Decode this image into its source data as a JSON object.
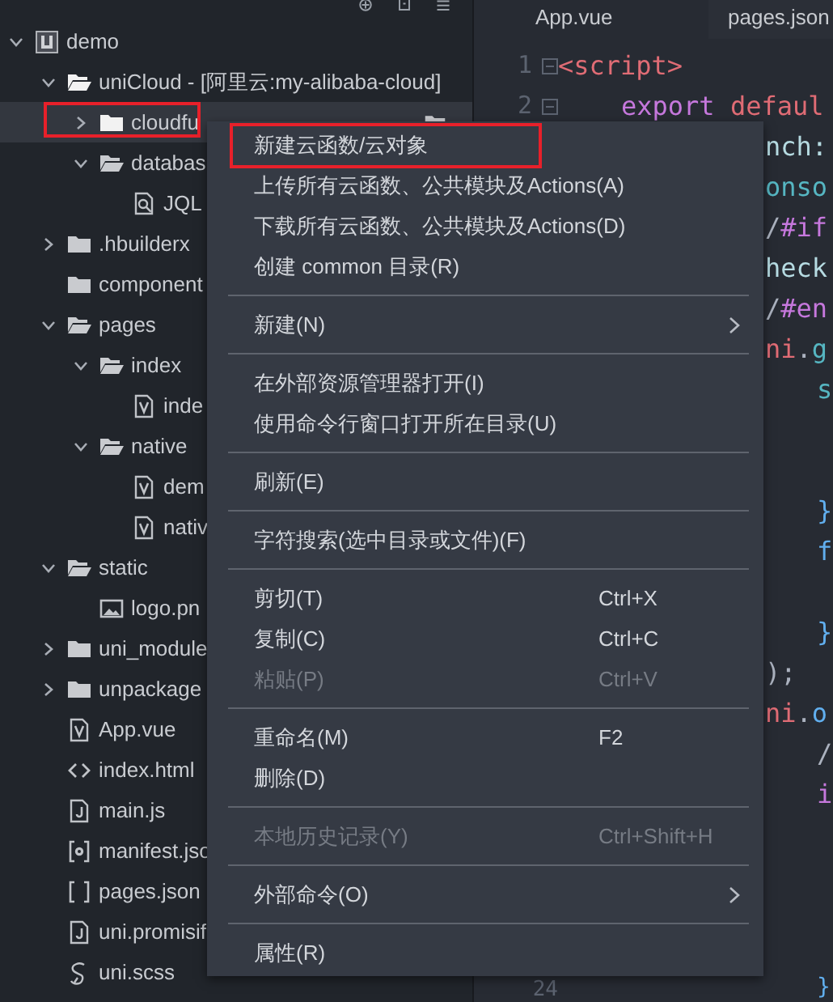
{
  "explorer": {
    "tree": [
      {
        "label": "demo",
        "kind": "project",
        "selected": false,
        "marked": false,
        "expanded": true,
        "children": [
          {
            "label": "uniCloud - [阿里云:my-alibaba-cloud]",
            "kind": "cloud-folder",
            "selected": false,
            "marked": false,
            "expanded": true,
            "children": [
              {
                "label": "cloudfu",
                "kind": "cloud-folder",
                "selected": true,
                "marked": true,
                "expanded": false
              },
              {
                "label": "databas",
                "kind": "folder",
                "selected": false,
                "marked": false,
                "expanded": true,
                "children": [
                  {
                    "label": "JQL",
                    "kind": "search-doc",
                    "selected": false,
                    "marked": false
                  }
                ]
              }
            ]
          },
          {
            "label": ".hbuilderx",
            "kind": "folder",
            "selected": false,
            "marked": false,
            "expanded": false
          },
          {
            "label": "component",
            "kind": "folder",
            "selected": false,
            "marked": false
          },
          {
            "label": "pages",
            "kind": "folder",
            "selected": false,
            "marked": false,
            "expanded": true,
            "children": [
              {
                "label": "index",
                "kind": "folder",
                "selected": false,
                "marked": false,
                "expanded": true,
                "children": [
                  {
                    "label": "inde",
                    "kind": "vue",
                    "selected": false,
                    "marked": false
                  }
                ]
              },
              {
                "label": "native",
                "kind": "folder",
                "selected": false,
                "marked": false,
                "expanded": true,
                "children": [
                  {
                    "label": "dem",
                    "kind": "vue",
                    "selected": false,
                    "marked": false
                  },
                  {
                    "label": "nativ",
                    "kind": "vue",
                    "selected": false,
                    "marked": false
                  }
                ]
              }
            ]
          },
          {
            "label": "static",
            "kind": "folder",
            "selected": false,
            "marked": false,
            "expanded": true,
            "children": [
              {
                "label": "logo.pn",
                "kind": "image",
                "selected": false,
                "marked": false
              }
            ]
          },
          {
            "label": "uni_module",
            "kind": "folder",
            "selected": false,
            "marked": false,
            "expanded": false
          },
          {
            "label": "unpackage",
            "kind": "folder",
            "selected": false,
            "marked": false,
            "expanded": false
          },
          {
            "label": "App.vue",
            "kind": "vue",
            "selected": false,
            "marked": false
          },
          {
            "label": "index.html",
            "kind": "html",
            "selected": false,
            "marked": false
          },
          {
            "label": "main.js",
            "kind": "js",
            "selected": false,
            "marked": false
          },
          {
            "label": "manifest.jso",
            "kind": "manifest",
            "selected": false,
            "marked": false
          },
          {
            "label": "pages.json",
            "kind": "json",
            "selected": false,
            "marked": false
          },
          {
            "label": "uni.promisif",
            "kind": "js",
            "selected": false,
            "marked": false
          },
          {
            "label": "uni.scss",
            "kind": "scss",
            "selected": false,
            "marked": false
          }
        ]
      }
    ]
  },
  "editor": {
    "tabs": [
      {
        "label": "App.vue",
        "selected": true
      },
      {
        "label": "pages.json",
        "selected": false
      }
    ],
    "lines": [
      {
        "kind": "margin",
        "number": "1",
        "foldable": true,
        "tokens": [
          {
            "text": "<script>",
            "kind": "tag"
          }
        ]
      },
      {
        "kind": "indented",
        "number": "2",
        "foldable": true,
        "tokens": [
          {
            "text": "export ",
            "kind": "keyword"
          },
          {
            "text": "defaul",
            "kind": "tag"
          }
        ]
      },
      {
        "kind": "under-menu",
        "tokens": [
          {
            "text": "nch:",
            "kind": "property"
          }
        ]
      },
      {
        "kind": "under-menu",
        "tokens": [
          {
            "text": "onso",
            "kind": "identifier"
          }
        ]
      },
      {
        "kind": "under-menu",
        "tokens": [
          {
            "text": "/",
            "kind": "punct"
          },
          {
            "text": "#if",
            "kind": "keyword"
          }
        ]
      },
      {
        "kind": "under-menu",
        "tokens": [
          {
            "text": "heck",
            "kind": "property"
          }
        ]
      },
      {
        "kind": "under-menu",
        "tokens": [
          {
            "text": "/",
            "kind": "punct"
          },
          {
            "text": "#en",
            "kind": "keyword"
          }
        ]
      },
      {
        "kind": "under-menu",
        "tokens": [
          {
            "text": "ni",
            "kind": "tag"
          },
          {
            "text": ".",
            "kind": "punct"
          },
          {
            "text": "g",
            "kind": "identifier"
          }
        ]
      },
      {
        "kind": "nested",
        "tokens": [
          {
            "text": "s",
            "kind": "identifier"
          }
        ]
      },
      {
        "kind": "blank"
      },
      {
        "kind": "blank"
      },
      {
        "kind": "nested",
        "tokens": [
          {
            "text": "}",
            "kind": "brace"
          }
        ]
      },
      {
        "kind": "nested",
        "tokens": [
          {
            "text": "f",
            "kind": "brace"
          }
        ]
      },
      {
        "kind": "blank"
      },
      {
        "kind": "nested",
        "tokens": [
          {
            "text": "}",
            "kind": "brace"
          }
        ]
      },
      {
        "kind": "under-menu",
        "tokens": [
          {
            "text": ");",
            "kind": "punct"
          }
        ]
      },
      {
        "kind": "under-menu",
        "tokens": [
          {
            "text": "ni",
            "kind": "tag"
          },
          {
            "text": ".",
            "kind": "punct"
          },
          {
            "text": "o",
            "kind": "brace"
          }
        ]
      },
      {
        "kind": "nested",
        "tokens": [
          {
            "text": "/",
            "kind": "punct"
          }
        ]
      },
      {
        "kind": "nested",
        "tokens": [
          {
            "text": "i",
            "kind": "keyword"
          }
        ]
      },
      {
        "kind": "blank"
      },
      {
        "kind": "blank"
      },
      {
        "kind": "blank"
      },
      {
        "kind": "blank"
      },
      {
        "kind": "nested",
        "number": "24",
        "foldable": false,
        "tokens": [
          {
            "text": "}",
            "kind": "brace"
          }
        ]
      }
    ]
  },
  "context_menu": {
    "items": [
      {
        "kind": "item",
        "label": "新建云函数/云对象",
        "disabled": false,
        "marked": true
      },
      {
        "kind": "item",
        "label": "上传所有云函数、公共模块及Actions(A)",
        "disabled": false,
        "marked": false
      },
      {
        "kind": "item",
        "label": "下载所有云函数、公共模块及Actions(D)",
        "disabled": false,
        "marked": false
      },
      {
        "kind": "item",
        "label": "创建 common 目录(R)",
        "disabled": false,
        "marked": false
      },
      {
        "kind": "separator"
      },
      {
        "kind": "item",
        "label": "新建(N)",
        "disabled": false,
        "marked": false,
        "submenu": true
      },
      {
        "kind": "separator"
      },
      {
        "kind": "item",
        "label": "在外部资源管理器打开(I)",
        "disabled": false,
        "marked": false
      },
      {
        "kind": "item",
        "label": "使用命令行窗口打开所在目录(U)",
        "disabled": false,
        "marked": false
      },
      {
        "kind": "separator"
      },
      {
        "kind": "item",
        "label": "刷新(E)",
        "disabled": false,
        "marked": false
      },
      {
        "kind": "separator"
      },
      {
        "kind": "item",
        "label": "字符搜索(选中目录或文件)(F)",
        "disabled": false,
        "marked": false
      },
      {
        "kind": "separator"
      },
      {
        "kind": "item",
        "label": "剪切(T)",
        "shortcut": "Ctrl+X",
        "disabled": false,
        "marked": false
      },
      {
        "kind": "item",
        "label": "复制(C)",
        "shortcut": "Ctrl+C",
        "disabled": false,
        "marked": false
      },
      {
        "kind": "item",
        "label": "粘贴(P)",
        "shortcut": "Ctrl+V",
        "disabled": true,
        "marked": false
      },
      {
        "kind": "separator"
      },
      {
        "kind": "item",
        "label": "重命名(M)",
        "shortcut": "F2",
        "disabled": false,
        "marked": false
      },
      {
        "kind": "item",
        "label": "删除(D)",
        "disabled": false,
        "marked": false
      },
      {
        "kind": "separator"
      },
      {
        "kind": "item",
        "label": "本地历史记录(Y)",
        "shortcut": "Ctrl+Shift+H",
        "disabled": true,
        "marked": false
      },
      {
        "kind": "separator"
      },
      {
        "kind": "item",
        "label": "外部命令(O)",
        "disabled": false,
        "marked": false,
        "submenu": true
      },
      {
        "kind": "separator"
      },
      {
        "kind": "item",
        "label": "属性(R)",
        "disabled": false,
        "marked": false
      }
    ]
  }
}
